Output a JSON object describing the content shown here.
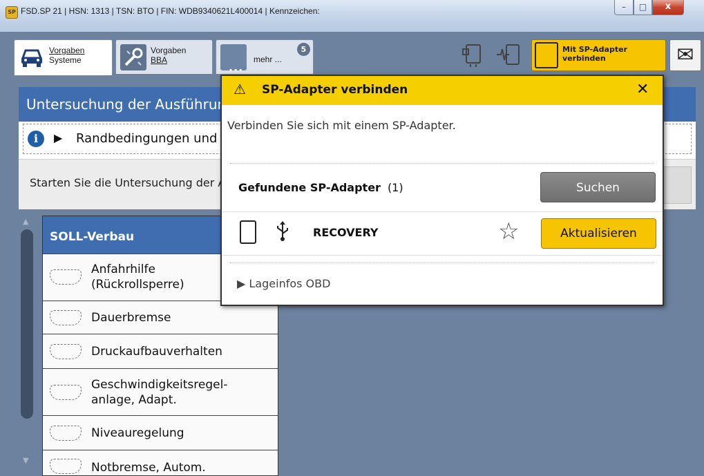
{
  "window": {
    "title": "FSD.SP 21 | HSN: 1313 | TSN: BTO | FIN: WDB9340621L400014 | Kennzeichen:",
    "app_icon_text": "SP",
    "minimize": "–",
    "maximize": "□",
    "close": "x"
  },
  "tabs": [
    {
      "label1": "Vorgaben",
      "label2": "Systeme",
      "icon": "car-front-icon"
    },
    {
      "label1": "Vorgaben",
      "label2": "BBA",
      "icon": "wrench-icon"
    },
    {
      "label": "mehr ...",
      "badge": "5",
      "icon": "more-dots-icon",
      "dots": "..."
    }
  ],
  "toolbar": {
    "connect_line1": "Mit SP-Adapter",
    "connect_line2": "verbinden",
    "mail_icon": "✉"
  },
  "panel": {
    "title": "Untersuchung der Ausführung",
    "conditions": "Randbedingungen und Hinweise",
    "start_text": "Starten Sie die Untersuchung der Ausführung"
  },
  "soll": {
    "header": "SOLL-Verbau",
    "items": [
      {
        "line1": "Anfahrhilfe",
        "line2": "(Rückrollsperre)"
      },
      {
        "line1": "Dauerbremse"
      },
      {
        "line1": "Druckaufbauverhalten"
      },
      {
        "line1": "Geschwindigkeitsregel-",
        "line2": "anlage, Adapt."
      },
      {
        "line1": "Niveauregelung"
      },
      {
        "line1": "Notbremse, Autom."
      }
    ]
  },
  "modal": {
    "title": "SP-Adapter verbinden",
    "warn_icon": "⚠",
    "close": "✕",
    "message": "Verbinden Sie sich mit einem SP-Adapter.",
    "found_label": "Gefundene SP-Adapter",
    "found_count": "(1)",
    "search_button": "Suchen",
    "adapter_name": "RECOVERY",
    "usb_icon": "⚲",
    "star_icon": "☆",
    "update_button": "Aktualisieren",
    "lage_arrow": "▶",
    "lage_label": "Lageinfos OBD"
  }
}
